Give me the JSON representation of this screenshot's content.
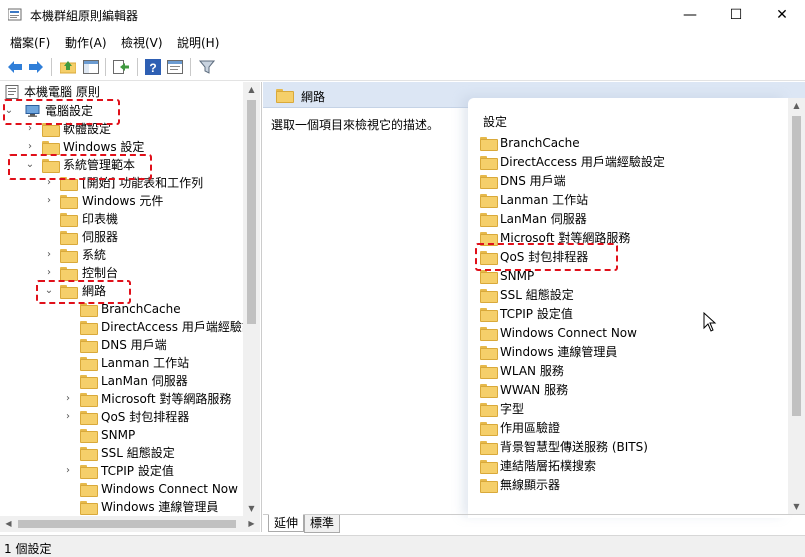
{
  "window": {
    "title": "本機群組原則編輯器",
    "minimize_glyph": "—",
    "maximize_glyph": "☐",
    "close_glyph": "✕"
  },
  "menu": [
    "檔案(F)",
    "動作(A)",
    "檢視(V)",
    "說明(H)"
  ],
  "toolbar_icons": [
    "back-arrow-icon",
    "forward-arrow-icon",
    "up-folder-icon",
    "show-hide-tree-icon",
    "export-list-icon",
    "help-icon",
    "properties-view-icon",
    "filter-icon"
  ],
  "tree": {
    "root": "本機電腦 原則",
    "computer_config": "電腦設定",
    "software_settings": "軟體設定",
    "windows_settings": "Windows 設定",
    "admin_templates": "系統管理範本",
    "admin_children": [
      "[開始] 功能表和工作列",
      "Windows 元件",
      "印表機",
      "伺服器",
      "系統",
      "控制台"
    ],
    "network": "網路",
    "network_children": [
      "BranchCache",
      "DirectAccess 用戶端經驗設",
      "DNS 用戶端",
      "Lanman 工作站",
      "LanMan 伺服器",
      "Microsoft 對等網路服務",
      "QoS 封包排程器",
      "SNMP",
      "SSL 組態設定",
      "TCPIP 設定值",
      "Windows Connect Now",
      "Windows 連線管理員"
    ]
  },
  "right": {
    "header": "網路",
    "description": "選取一個項目來檢視它的描述。",
    "column_header": "設定",
    "items": [
      "BranchCache",
      "DirectAccess 用戶端經驗設定",
      "DNS 用戶端",
      "Lanman 工作站",
      "LanMan 伺服器",
      "Microsoft 對等網路服務",
      "QoS 封包排程器",
      "SNMP",
      "SSL 組態設定",
      "TCPIP 設定值",
      "Windows Connect Now",
      "Windows 連線管理員",
      "WLAN 服務",
      "WWAN 服務",
      "字型",
      "作用區驗證",
      "背景智慧型傳送服務 (BITS)",
      "連結階層拓樸搜索",
      "無線顯示器"
    ]
  },
  "tabs": [
    "延伸",
    "標準"
  ],
  "status": "1 個設定",
  "colors": {
    "highlight_dash": "#e0101a",
    "header_bg": "#dce6f4",
    "folder": "#f5cf6a"
  }
}
